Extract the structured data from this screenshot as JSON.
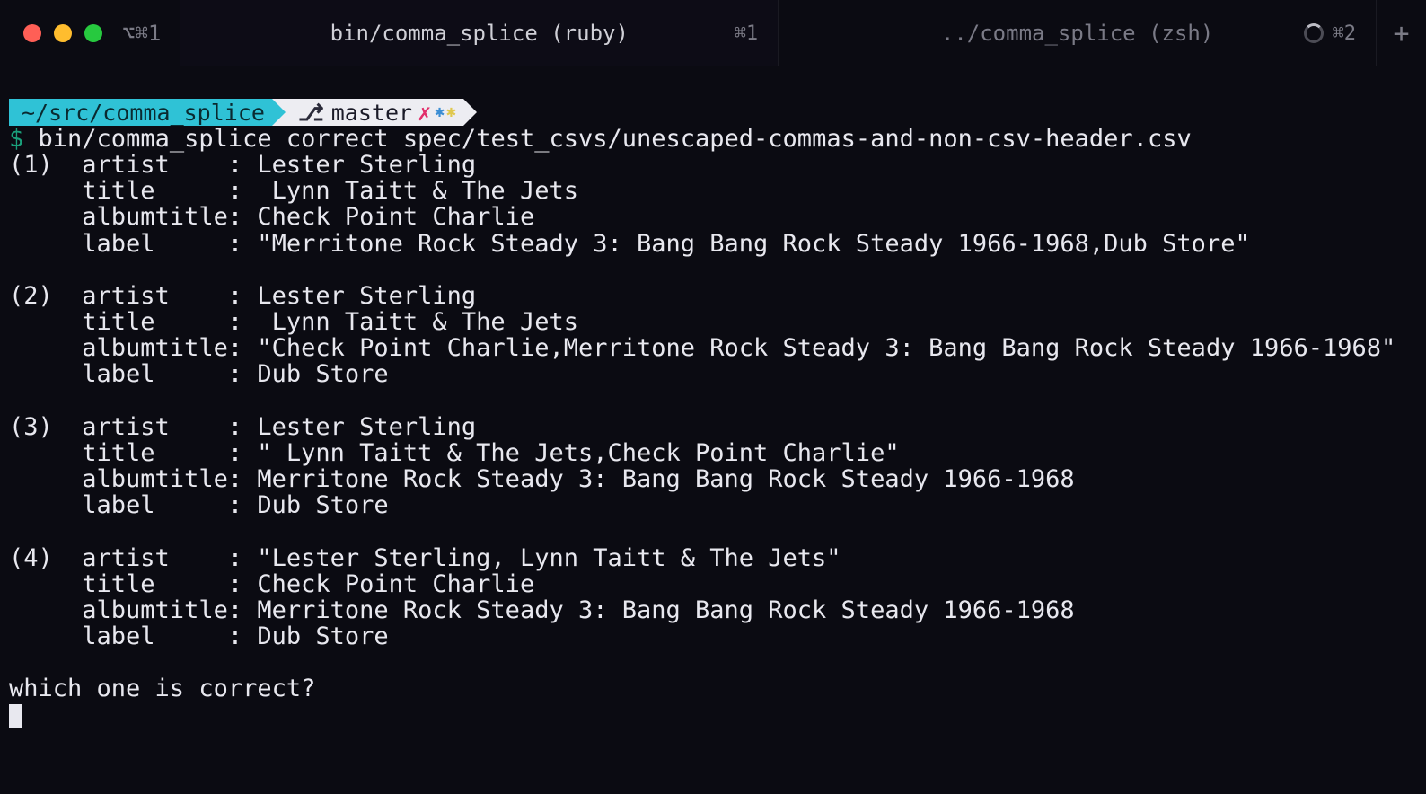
{
  "titlebar": {
    "pretab_icon": "⌥⌘1",
    "tabs": [
      {
        "label": "bin/comma_splice (ruby)",
        "shortcut": "⌘1",
        "active": true
      },
      {
        "label": "../comma_splice (zsh)",
        "shortcut": "⌘2",
        "active": false,
        "spinner": true
      }
    ]
  },
  "prompt": {
    "path": "~/src/comma_splice",
    "branch": "master",
    "dollar": "$",
    "command": "bin/comma_splice correct spec/test_csvs/unescaped-commas-and-non-csv-header.csv"
  },
  "options": [
    {
      "num": "(1)",
      "artist": "Lester Sterling",
      "title": " Lynn Taitt & The Jets",
      "albumtitle": "Check Point Charlie",
      "label": "\"Merritone Rock Steady 3: Bang Bang Rock Steady 1966-1968,Dub Store\""
    },
    {
      "num": "(2)",
      "artist": "Lester Sterling",
      "title": " Lynn Taitt & The Jets",
      "albumtitle": "\"Check Point Charlie,Merritone Rock Steady 3: Bang Bang Rock Steady 1966-1968\"",
      "label": "Dub Store"
    },
    {
      "num": "(3)",
      "artist": "Lester Sterling",
      "title": "\" Lynn Taitt & The Jets,Check Point Charlie\"",
      "albumtitle": "Merritone Rock Steady 3: Bang Bang Rock Steady 1966-1968",
      "label": "Dub Store"
    },
    {
      "num": "(4)",
      "artist": "\"Lester Sterling, Lynn Taitt & The Jets\"",
      "title": "Check Point Charlie",
      "albumtitle": "Merritone Rock Steady 3: Bang Bang Rock Steady 1966-1968",
      "label": "Dub Store"
    }
  ],
  "question": "which one is correct?",
  "field_labels": {
    "artist": "artist    :",
    "title": "title     :",
    "albumtitle": "albumtitle:",
    "label": "label     :"
  }
}
